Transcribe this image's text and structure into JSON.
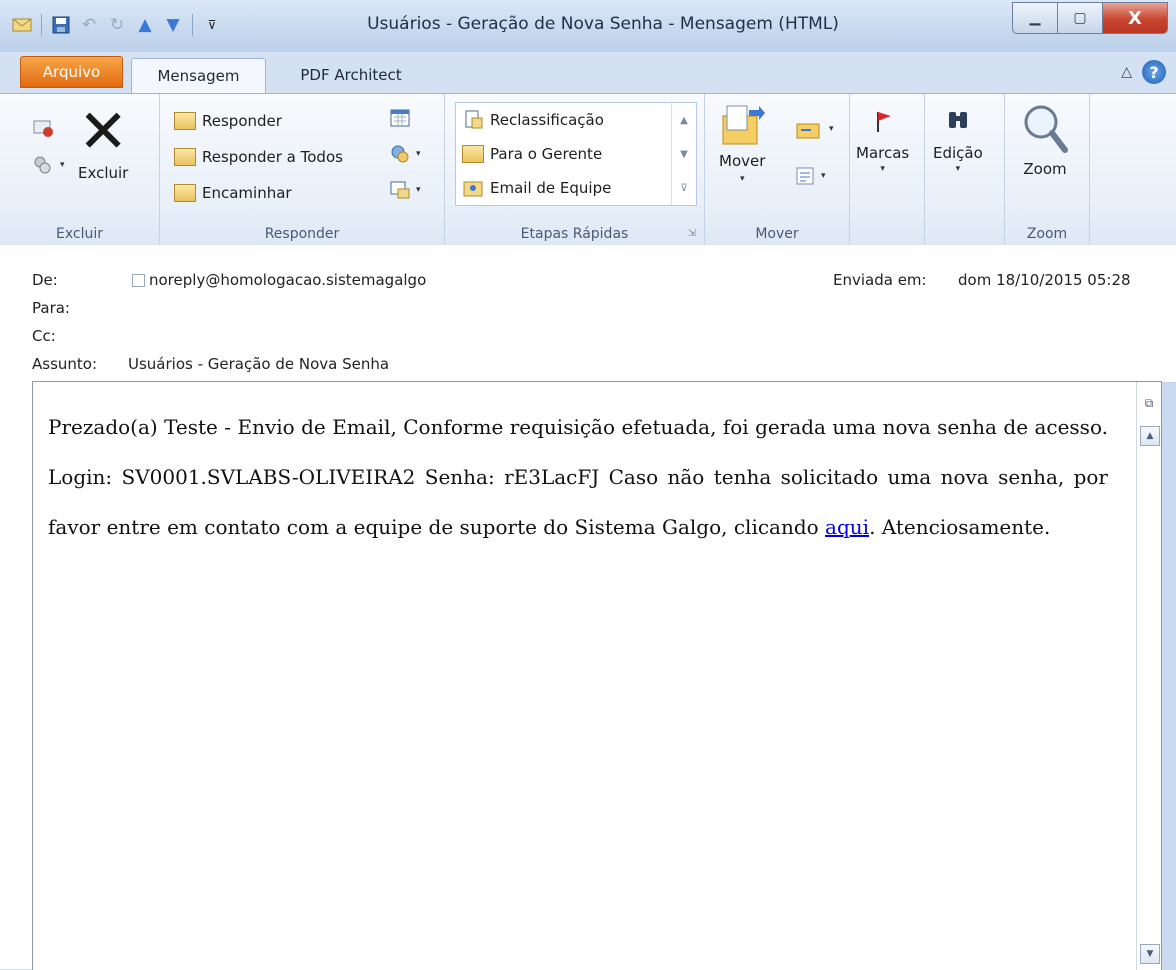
{
  "window": {
    "title": "Usuários - Geração de Nova Senha  -  Mensagem (HTML)",
    "minimize_icon": "minimize-icon",
    "maximize_icon": "maximize-icon",
    "close_label": "X"
  },
  "qat": {
    "icons": [
      "envelope-icon",
      "save-icon",
      "undo-icon",
      "redo-icon",
      "up-arrow-icon",
      "down-arrow-icon",
      "customize-icon"
    ]
  },
  "tabs": {
    "arquivo": "Arquivo",
    "mensagem": "Mensagem",
    "pdf": "PDF Architect"
  },
  "ribbon": {
    "excluir_group": {
      "label": "Excluir",
      "delete_button": "Excluir"
    },
    "responder_group": {
      "label": "Responder",
      "reply": "Responder",
      "reply_all": "Responder a Todos",
      "forward": "Encaminhar"
    },
    "etapas_group": {
      "label": "Etapas Rápidas",
      "items": [
        "Reclassificação",
        "Para o Gerente",
        "Email de Equipe"
      ]
    },
    "mover_group": {
      "label": "Mover",
      "move_button": "Mover"
    },
    "marcas_group": {
      "button": "Marcas"
    },
    "edicao_group": {
      "button": "Edição"
    },
    "zoom_group": {
      "label": "Zoom",
      "button": "Zoom"
    }
  },
  "header": {
    "from_label": "De:",
    "from_value": "noreply@homologacao.sistemagalgo",
    "to_label": "Para:",
    "cc_label": "Cc:",
    "subject_label": "Assunto:",
    "subject_value": "Usuários - Geração de Nova Senha",
    "sent_label": "Enviada em:",
    "sent_value": "dom 18/10/2015 05:28"
  },
  "body": {
    "text_before_link": "Prezado(a) Teste - Envio de Email, Conforme requisição efetuada, foi gerada uma nova senha de acesso. Login: SV0001.SVLABS-OLIVEIRA2 Senha: rE3LacFJ Caso não tenha solicitado uma nova senha, por favor entre em contato com a equipe de suporte do Sistema Galgo, clicando ",
    "link_text": "aqui",
    "text_after_link": ". Atenciosamente."
  },
  "colors": {
    "arquivo_tab": "#e46b0f",
    "close_button": "#c8452f",
    "link": "#0000ee"
  }
}
